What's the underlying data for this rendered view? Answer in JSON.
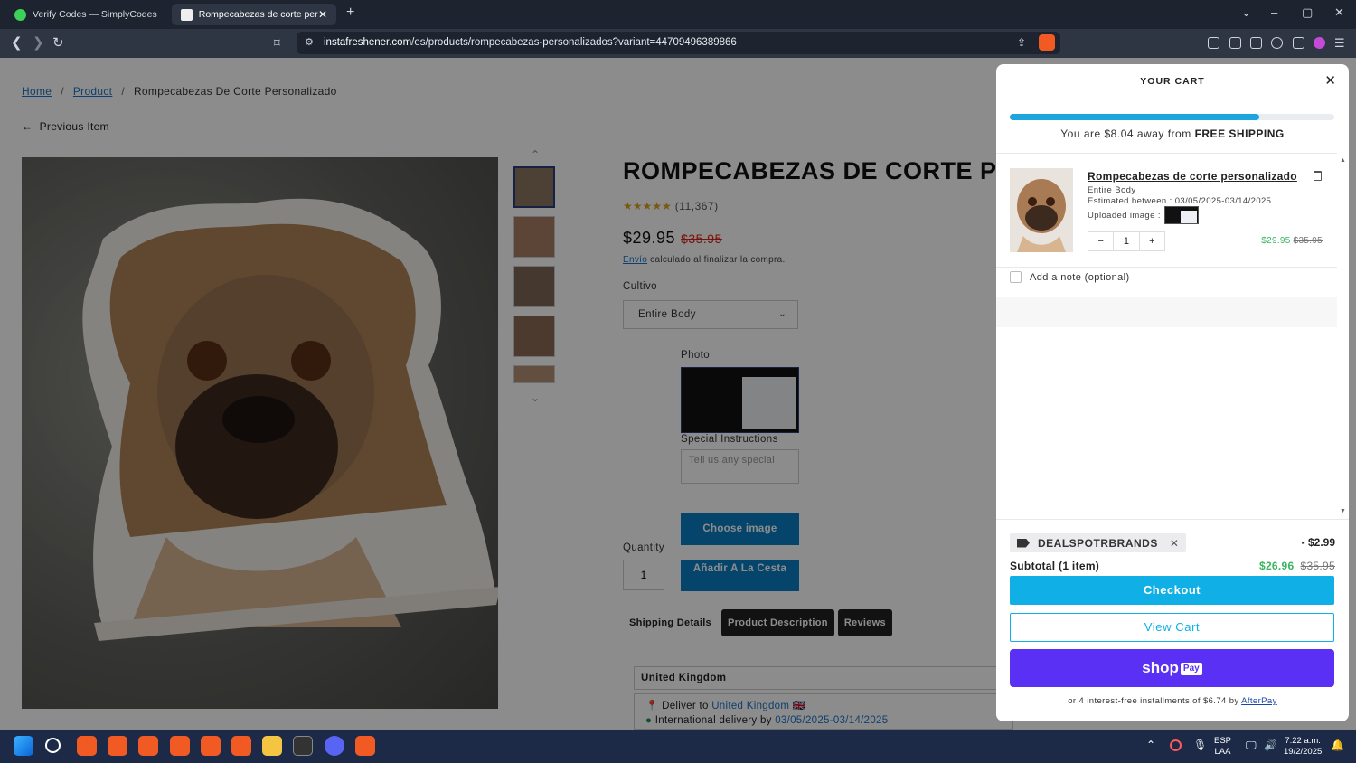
{
  "browser": {
    "tabs": [
      {
        "title": "Verify Codes — SimplyCodes",
        "active": false
      },
      {
        "title": "Rompecabezas de corte person",
        "active": true
      }
    ],
    "url_host": "instafreshener.com",
    "url_path": "/es/products/rompecabezas-personalizados?variant=44709496389866"
  },
  "page": {
    "breadcrumb": {
      "home": "Home",
      "sep": "/",
      "product": "Product",
      "current": "Rompecabezas De Corte Personalizado"
    },
    "previous_label": "Previous Item",
    "title": "ROMPECABEZAS DE CORTE PERS",
    "rating_count": "(11,367)",
    "price": "$29.95",
    "compare_price": "$35.95",
    "shipping_link": "Envío",
    "shipping_note": " calculado al finalizar la compra.",
    "crop_label": "Cultivo",
    "crop_value": "Entire Body",
    "photo_label": "Photo",
    "special_label": "Special Instructions",
    "special_placeholder": "Tell us any special",
    "choose_image": "Choose image",
    "quantity_label": "Quantity",
    "quantity_value": "1",
    "add_to_cart": "Añadir A La Cesta",
    "tabs": [
      "Shipping Details",
      "Product Description",
      "Reviews"
    ],
    "country": "United Kingdom",
    "deliver_to_prefix": "Deliver to ",
    "deliver_to_country": "United Kingdom",
    "intl_prefix": "International delivery by ",
    "intl_dates": "03/05/2025-03/14/2025"
  },
  "cart": {
    "title": "YOUR CART",
    "shipping_progress": 0.77,
    "shipping_msg_prefix": "You are $8.04 away from ",
    "shipping_msg_bold": "FREE SHIPPING",
    "item": {
      "name": "Rompecabezas de corte personalizado",
      "variant": "Entire Body",
      "estimated": "Estimated between : 03/05/2025-03/14/2025",
      "uploaded": "Uploaded image :",
      "qty": "1",
      "price": "$29.95",
      "compare": "$35.95"
    },
    "note_label": "Add a note (optional)",
    "discount_code": "DEALSPOTRBRANDS",
    "discount_amount": "- $2.99",
    "subtotal_label": "Subtotal (1 item)",
    "subtotal": "$26.96",
    "subtotal_compare": "$35.95",
    "checkout": "Checkout",
    "view_cart": "View Cart",
    "shop_pay_a": "shop",
    "shop_pay_b": "Pay",
    "afterpay_prefix": "or 4 interest-free installments of $6.74 by ",
    "afterpay_link": "AfterPay"
  },
  "taskbar": {
    "lang_top": "ESP",
    "lang_bottom": "LAA",
    "time": "7:22 a.m.",
    "date": "19/2/2025"
  },
  "colors": {
    "accent": "#10b0e6",
    "shoppay": "#5a31f4",
    "sale": "#3bb560"
  }
}
